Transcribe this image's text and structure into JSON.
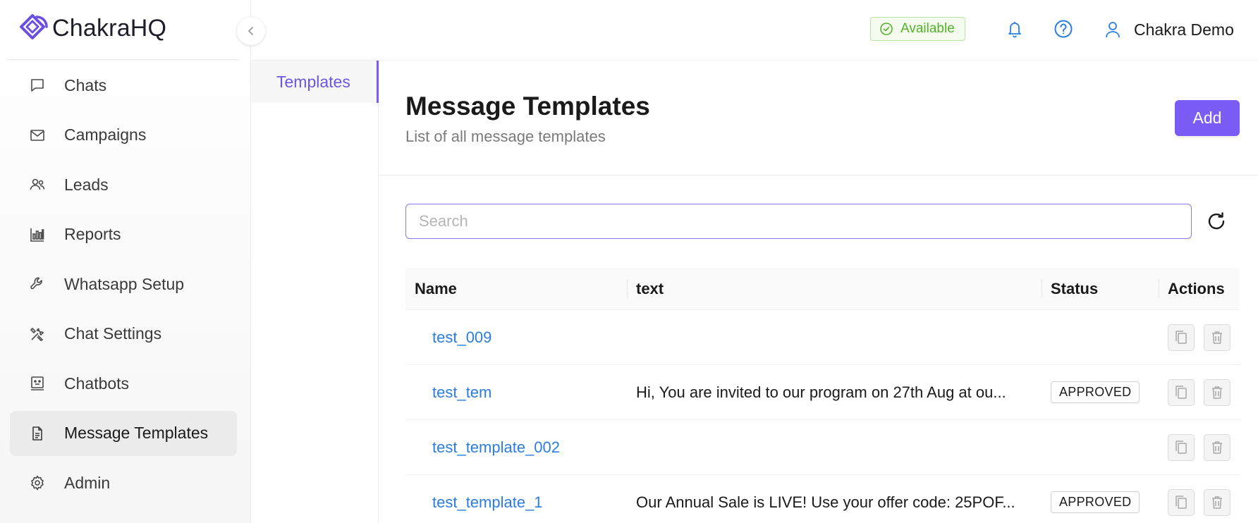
{
  "app": {
    "name": "ChakraHQ"
  },
  "header": {
    "status_label": "Available",
    "user_name": "Chakra Demo",
    "colors": {
      "status_green": "#52b32a",
      "icon_blue": "#2a7de1"
    }
  },
  "sidebar": {
    "items": [
      {
        "label": "Chats",
        "icon": "chat-bubble-icon"
      },
      {
        "label": "Campaigns",
        "icon": "envelope-icon"
      },
      {
        "label": "Leads",
        "icon": "users-icon"
      },
      {
        "label": "Reports",
        "icon": "bar-chart-icon"
      },
      {
        "label": "Whatsapp Setup",
        "icon": "wrench-icon"
      },
      {
        "label": "Chat Settings",
        "icon": "tools-icon"
      },
      {
        "label": "Chatbots",
        "icon": "bot-icon"
      },
      {
        "label": "Message Templates",
        "icon": "document-icon",
        "active": true
      },
      {
        "label": "Admin",
        "icon": "gear-icon"
      }
    ]
  },
  "subnav": {
    "items": [
      {
        "label": "Templates",
        "active": true
      }
    ]
  },
  "main": {
    "title": "Message Templates",
    "subtitle": "List of all message templates",
    "add_label": "Add",
    "search_placeholder": "Search",
    "accent": "#7b5cf5"
  },
  "table": {
    "columns": [
      "Name",
      "text",
      "Status",
      "Actions"
    ],
    "rows": [
      {
        "name": "test_009",
        "text": "",
        "status": ""
      },
      {
        "name": "test_tem",
        "text": "Hi, You are invited to our program on 27th Aug at ou...",
        "status": "APPROVED"
      },
      {
        "name": "test_template_002",
        "text": "",
        "status": ""
      },
      {
        "name": "test_template_1",
        "text": "Our Annual Sale is LIVE! Use your offer code: 25POF...",
        "status": "APPROVED"
      }
    ]
  }
}
